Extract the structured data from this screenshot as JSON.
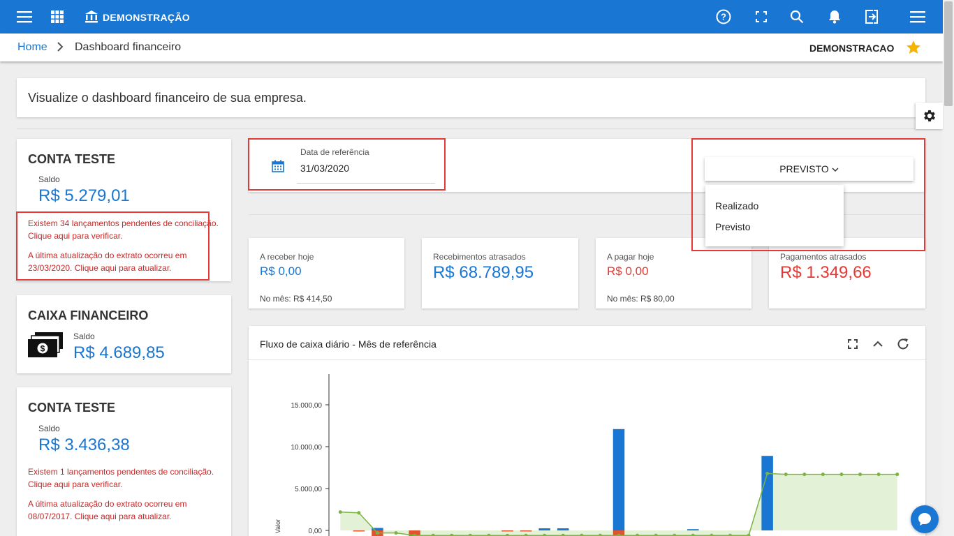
{
  "topbar": {
    "brand": "DEMONSTRAÇÃO",
    "icons": [
      "menu-icon",
      "apps-icon",
      "bank-icon",
      "help-icon",
      "fullscreen-icon",
      "search-icon",
      "bell-icon",
      "logout-icon",
      "more-menu-icon"
    ]
  },
  "breadcrumb": {
    "home": "Home",
    "current": "Dashboard financeiro",
    "company": "DEMONSTRACAO"
  },
  "intro": {
    "text": "Visualize o dashboard financeiro de sua empresa."
  },
  "accounts": [
    {
      "name": "CONTA TESTE",
      "balance_label": "Saldo",
      "balance": "R$ 5.279,01",
      "pending_msg": "Existem 34 lançamentos pendentes de conciliação. Clique aqui para verificar.",
      "update_msg": "A última atualização do extrato ocorreu em 23/03/2020. Clique aqui para atualizar."
    },
    {
      "name": "CAIXA FINANCEIRO",
      "balance_label": "Saldo",
      "balance": "R$ 4.689,85"
    },
    {
      "name": "CONTA TESTE",
      "balance_label": "Saldo",
      "balance": "R$ 3.436,38",
      "pending_msg": "Existem 1 lançamentos pendentes de conciliação. Clique aqui para verificar.",
      "update_msg": "A última atualização do extrato ocorreu em 08/07/2017. Clique aqui para atualizar."
    }
  ],
  "filters": {
    "date_label": "Data de referência",
    "date_value": "31/03/2020",
    "mode_selected": "PREVISTO",
    "mode_options": [
      "Realizado",
      "Previsto"
    ]
  },
  "kpis": [
    {
      "label": "A receber hoje",
      "value": "R$ 0,00",
      "sub": "No mês: R$ 414,50",
      "color": "#1976d2"
    },
    {
      "label": "Recebimentos atrasados",
      "value": "R$ 68.789,95",
      "sub": "",
      "color": "#1976d2"
    },
    {
      "label": "A pagar hoje",
      "value": "R$ 0,00",
      "sub": "No mês: R$ 80,00",
      "color": "#e53935"
    },
    {
      "label": "Pagamentos atrasados",
      "value": "R$ 1.349,66",
      "sub": "",
      "color": "#e53935"
    }
  ],
  "chart": {
    "title": "Fluxo de caixa diário - Mês de referência",
    "tools": [
      "fullscreen-icon",
      "collapse-icon",
      "refresh-icon"
    ]
  },
  "chart_data": {
    "type": "bar",
    "ylabel": "Valor",
    "yticks": [
      "0,00",
      "5.000,00",
      "10.000,00",
      "15.000,00"
    ],
    "ylim": [
      0,
      17500
    ],
    "days": 31,
    "series": [
      {
        "name": "",
        "color": "#1976d2",
        "values": [
          0,
          0,
          300,
          0,
          0,
          0,
          0,
          0,
          0,
          0,
          0,
          250,
          250,
          0,
          0,
          12100,
          0,
          0,
          0,
          150,
          0,
          0,
          0,
          8900,
          0,
          0,
          0,
          0,
          0,
          0,
          0
        ]
      },
      {
        "name": "",
        "color": "#e0532f",
        "values": [
          0,
          -100,
          -800,
          0,
          -700,
          0,
          0,
          0,
          0,
          -120,
          -120,
          0,
          0,
          0,
          0,
          -700,
          0,
          0,
          0,
          0,
          0,
          0,
          0,
          0,
          0,
          0,
          0,
          0,
          0,
          0,
          0
        ]
      }
    ],
    "line": {
      "name": "",
      "color": "#7cb342",
      "values": [
        2200,
        2100,
        -300,
        -300,
        -600,
        -600,
        -600,
        -600,
        -600,
        -600,
        -600,
        -600,
        -600,
        -600,
        -600,
        -600,
        -600,
        -600,
        -600,
        -600,
        -600,
        -600,
        -600,
        6800,
        6700,
        6700,
        6700,
        6700,
        6700,
        6700,
        6700
      ]
    }
  }
}
